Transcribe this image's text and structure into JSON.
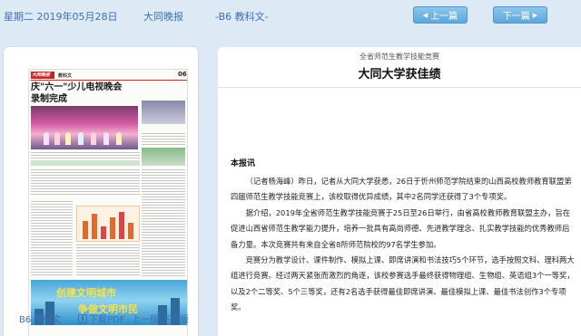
{
  "topbar": {
    "date": "星期二 2019年05月28日",
    "paper_name": "大同晚报",
    "section": "-B6 教科文-",
    "prev_button": "上一篇",
    "next_button": "下一篇"
  },
  "thumbnail": {
    "masthead": "大同晚报",
    "section_label": "教科文",
    "page_number": "06",
    "headline": "庆\"六一\"少儿电视晚会录制完成",
    "banner_line1": "创建文明城市",
    "banner_line2": "争做文明市民"
  },
  "left_footer": {
    "section": "B6 教科文",
    "download": "下载PDF",
    "prev_page": "上一版",
    "separator": "|",
    "next_page": "下一版"
  },
  "article": {
    "kicker": "全省师范生教学技能竞赛",
    "title": "大同大学获佳绩",
    "byline": "本报讯",
    "paragraphs": [
      "（记者杨海峰）昨日，记者从大同大学获悉，26日于忻州师范学院结束的山西高校教师教育联盟第四届师范生教学技能竞赛上，该校取得优异成绩，其中2名同学还获得了3个专项奖。",
      "据介绍，2019年全省师范生教学技能竞赛于25日至26日举行，由省高校教师教育联盟主办，旨在促进山西省师范生教学能力提升，培养一批具有高尚师德、先进教学理念、扎实教学技能的优秀教师后备力量。本次竞赛共有来自全省8所师范院校的97名学生参加。",
      "竞赛分为教学设计、课件制作、模拟上课、即席讲演和书法技巧5个环节，选手按照文科、理科两大组进行竞赛。经过两天紧张而激烈的角逐，该校参赛选手最终获得物理组、生物组、英语组3个一等奖，以及2个二等奖、5个三等奖，还有2名选手获得最佳即席讲演、最佳模拟上课、最佳书法创作3个专项奖。"
    ]
  },
  "colors": {
    "background": "#dde9f4",
    "accent_blue": "#3d6fb5",
    "button_blue": "#5aa7dd",
    "masthead_red": "#c72424"
  }
}
